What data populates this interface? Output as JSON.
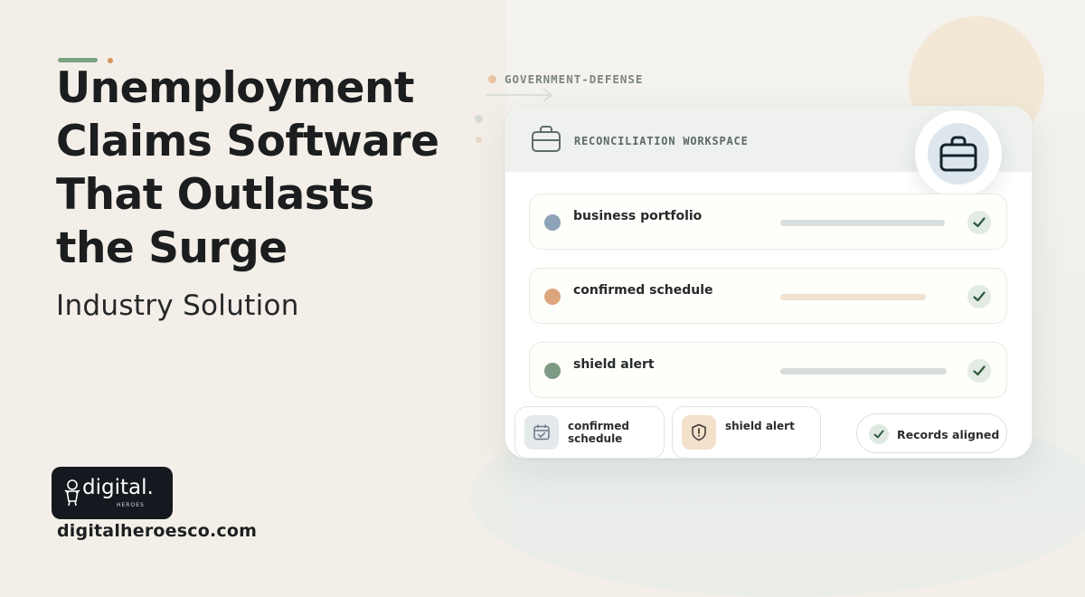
{
  "headline": {
    "line1": "Unemployment",
    "line2": "Claims Software",
    "line3": "That Outlasts",
    "line4": "the Surge"
  },
  "subheadline": "Industry Solution",
  "brand": {
    "logo_word": "digital.",
    "logo_sub": "HEROES",
    "website": "digitalheroesco.com"
  },
  "category_tag": "GOVERNMENT-DEFENSE",
  "workspace": {
    "title": "RECONCILIATION WORKSPACE",
    "header_icon": "briefcase-icon",
    "badge_icon": "briefcase-icon",
    "rows": [
      {
        "label": "business portfolio",
        "dot_color": "#8fa3b8",
        "bar_color": "#d9dedf",
        "status_icon": "check-icon"
      },
      {
        "label": "confirmed schedule",
        "dot_color": "#dda57d",
        "bar_color": "#f1e1cf",
        "status_icon": "check-icon"
      },
      {
        "label": "shield alert",
        "dot_color": "#7d9a84",
        "bar_color": "#d6ddd8",
        "status_icon": "check-icon"
      }
    ],
    "chips": [
      {
        "label_line1": "confirmed",
        "label_line2": "schedule",
        "icon": "calendar-check-icon",
        "icon_bg": "#e4e9ec"
      },
      {
        "label_line1": "shield alert",
        "label_line2": "",
        "icon": "shield-alert-icon",
        "icon_bg": "#f4e1cc"
      }
    ],
    "status_pill": {
      "label": "Records aligned",
      "icon": "check-icon"
    }
  },
  "colors": {
    "background": "#f3efe8",
    "accent_green": "#7ba483",
    "accent_orange": "#d6935d",
    "check_green": "#2f5a3c"
  }
}
